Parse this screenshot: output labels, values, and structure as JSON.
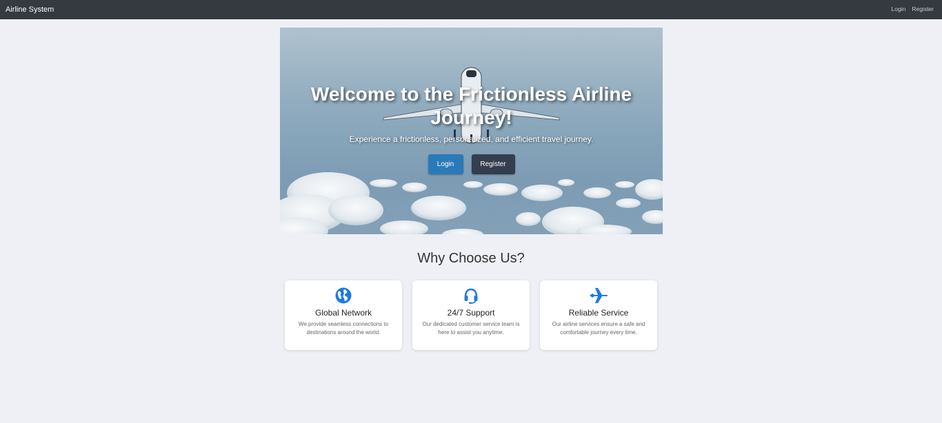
{
  "nav": {
    "brand": "Airline System",
    "links": [
      "Login",
      "Register"
    ]
  },
  "hero": {
    "title": "Welcome to the Frictionless Airline Journey!",
    "subtitle": "Experience a frictionless, personalized, and efficient travel journey.",
    "login_label": "Login",
    "register_label": "Register"
  },
  "section": {
    "title": "Why Choose Us?"
  },
  "features": [
    {
      "icon": "globe-icon",
      "title": "Global Network",
      "desc": "We provide seamless connections to destinations around the world."
    },
    {
      "icon": "headset-icon",
      "title": "24/7 Support",
      "desc": "Our dedicated customer service team is here to assist you anytime."
    },
    {
      "icon": "airplane-icon",
      "title": "Reliable Service",
      "desc": "Our airline services ensure a safe and comfortable journey every time."
    }
  ],
  "colors": {
    "accent": "#2a7ab8",
    "icon": "#1f7ae0",
    "navbar": "#343a40"
  }
}
